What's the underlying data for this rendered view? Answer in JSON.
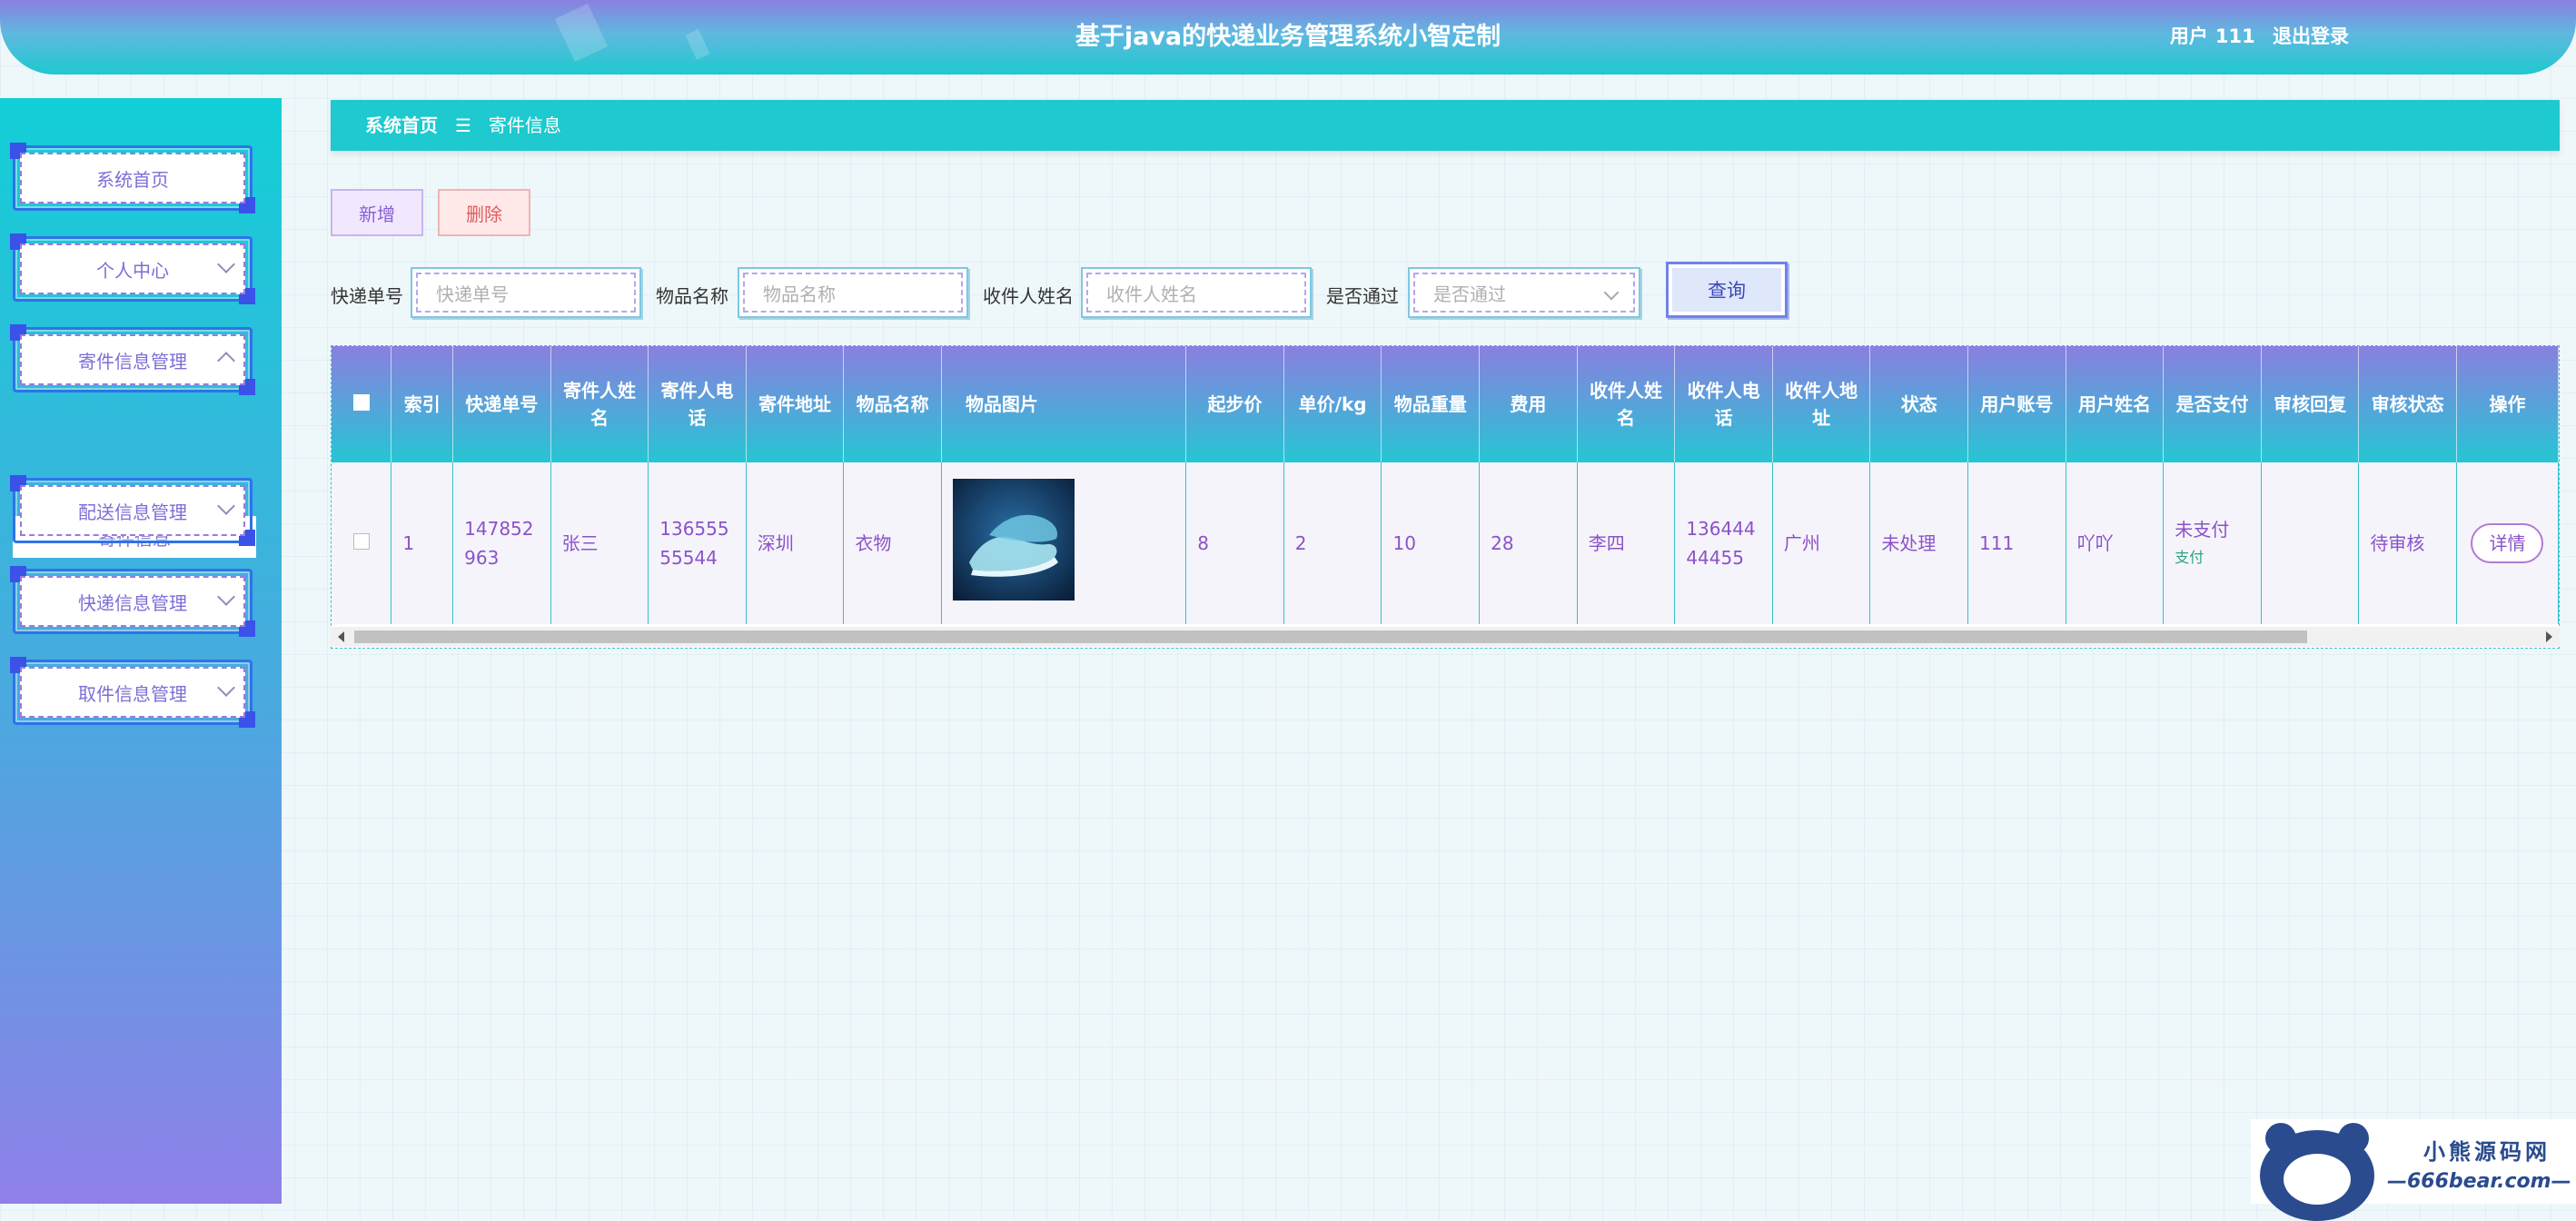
{
  "header": {
    "title": "基于java的快递业务管理系统小智定制",
    "user_label": "用户",
    "user_name": "111",
    "logout": "退出登录"
  },
  "sidebar": {
    "items": [
      {
        "label": "系统首页"
      },
      {
        "label": "个人中心"
      },
      {
        "label": "寄件信息管理"
      },
      {
        "label": "配送信息管理"
      },
      {
        "label": "快递信息管理"
      },
      {
        "label": "取件信息管理"
      }
    ],
    "sub_item": "寄件信息"
  },
  "breadcrumb": {
    "home": "系统首页",
    "sep": "☰",
    "current": "寄件信息"
  },
  "toolbar": {
    "add": "新增",
    "delete": "删除",
    "query": "查询"
  },
  "search": {
    "tracking_label": "快递单号",
    "tracking_placeholder": "快递单号",
    "item_label": "物品名称",
    "item_placeholder": "物品名称",
    "receiver_label": "收件人姓名",
    "receiver_placeholder": "收件人姓名",
    "approved_label": "是否通过",
    "approved_placeholder": "是否通过"
  },
  "table": {
    "headers": {
      "index": "索引",
      "tracking": "快递单号",
      "sender_name": "寄件人姓名",
      "sender_phone": "寄件人电话",
      "sender_addr": "寄件地址",
      "item_name": "物品名称",
      "item_image": "物品图片",
      "base_price": "起步价",
      "unit_price": "单价/kg",
      "weight": "物品重量",
      "fee": "费用",
      "receiver_name": "收件人姓名",
      "receiver_phone": "收件人电话",
      "receiver_addr": "收件人地址",
      "status": "状态",
      "account": "用户账号",
      "user_name": "用户姓名",
      "paid": "是否支付",
      "review_reply": "审核回复",
      "review_status": "审核状态",
      "actions": "操作"
    },
    "row": {
      "index": "1",
      "tracking": "147852963",
      "sender_name": "张三",
      "sender_phone": "13655555544",
      "sender_addr": "深圳",
      "item_name": "衣物",
      "base_price": "8",
      "unit_price": "2",
      "weight": "10",
      "fee": "28",
      "receiver_name": "李四",
      "receiver_phone": "13644444455",
      "receiver_addr": "广州",
      "status": "未处理",
      "account": "111",
      "user_name": "吖吖",
      "paid": "未支付",
      "pay_link": "支付",
      "review_reply": "",
      "review_status": "待审核",
      "detail": "详情"
    }
  },
  "watermark": {
    "cn": "小熊源码网",
    "url": "—666bear.com—"
  }
}
